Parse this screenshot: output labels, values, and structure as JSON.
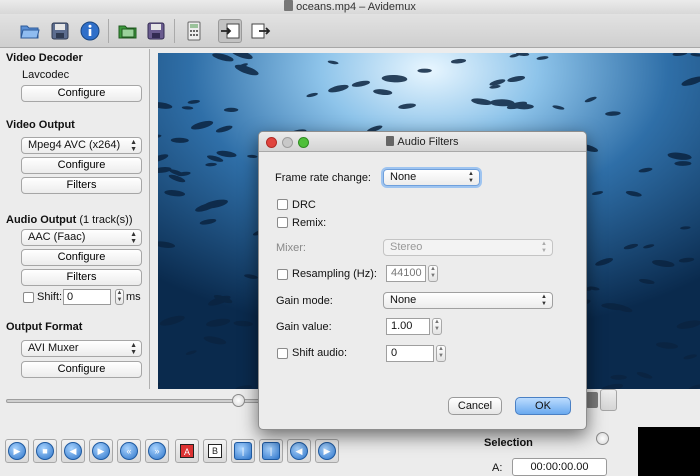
{
  "window": {
    "title": "oceans.mp4 – Avidemux"
  },
  "toolbar": {
    "icons": [
      "open-folder-icon",
      "save-icon",
      "info-icon",
      "open-image-icon",
      "save-image-icon",
      "calculator-icon",
      "import-icon",
      "export-icon"
    ]
  },
  "left_panel": {
    "video_decoder": {
      "title": "Video Decoder",
      "codec": "Lavcodec",
      "configure": "Configure"
    },
    "video_output": {
      "title": "Video Output",
      "codec": "Mpeg4 AVC (x264)",
      "configure": "Configure",
      "filters": "Filters"
    },
    "audio_output": {
      "title": "Audio Output",
      "tracks": "(1 track(s))",
      "codec": "AAC (Faac)",
      "configure": "Configure",
      "filters": "Filters",
      "shift_label": "Shift:",
      "shift_value": "0",
      "shift_unit": "ms"
    },
    "output_format": {
      "title": "Output Format",
      "muxer": "AVI Muxer",
      "configure": "Configure"
    }
  },
  "bottom": {
    "selection_label": "Selection",
    "a_label": "A:",
    "a_value": "00:00:00.00",
    "playback_icons": [
      "play-icon",
      "stop-icon",
      "previous-frame-icon",
      "next-frame-icon",
      "previous-keyframe-icon",
      "next-keyframe-icon",
      "set-marker-a-icon",
      "set-marker-b-icon",
      "goto-marker-a-icon",
      "goto-marker-b-icon",
      "previous-black-frame-icon",
      "next-black-frame-icon"
    ],
    "marker_a_glyph": "A",
    "marker_b_glyph": "B"
  },
  "dialog": {
    "title": "Audio Filters",
    "frame_rate_label": "Frame rate change:",
    "frame_rate_value": "None",
    "drc_label": "DRC",
    "remix_label": "Remix:",
    "mixer_label": "Mixer:",
    "mixer_value": "Stereo",
    "resampling_label": "Resampling (Hz):",
    "resampling_value": "44100",
    "gain_mode_label": "Gain mode:",
    "gain_mode_value": "None",
    "gain_value_label": "Gain value:",
    "gain_value": "1.00",
    "shift_audio_label": "Shift audio:",
    "shift_audio_value": "0",
    "cancel": "Cancel",
    "ok": "OK"
  },
  "colors": {
    "accent_blue": "#6aa9ef",
    "close_red": "#e0443e",
    "minimize_yellow": "#dea123",
    "zoom_green": "#4fbf3a"
  }
}
